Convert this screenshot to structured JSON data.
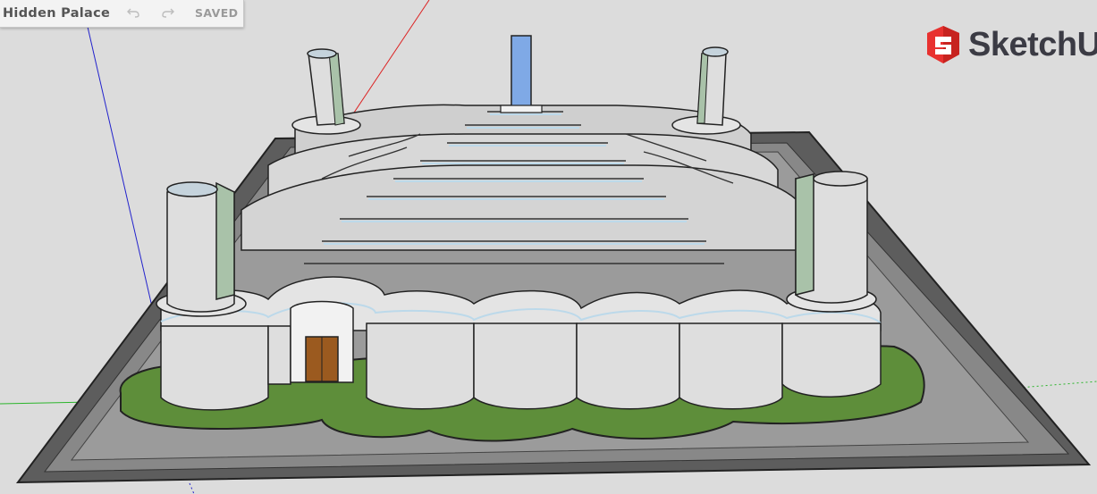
{
  "document": {
    "title": "Hidden Palace",
    "save_status": "SAVED"
  },
  "toolbar": {
    "undo_icon": "undo-icon",
    "redo_icon": "redo-icon"
  },
  "brand": {
    "name": "SketchU",
    "logo_icon": "sketchup-logo-icon",
    "logo_color": "#e8312f"
  },
  "colors": {
    "background": "#dcdcdc",
    "ground_plate": "#5d5d5d",
    "lawn": "#5e8e3a",
    "wall": "#dedede",
    "water_column": "#7fa9e6",
    "glass": "#a9c2a9",
    "door": "#9b5a1f",
    "axis_red": "#dd2222",
    "axis_green": "#2bb52b",
    "axis_blue": "#2222cc"
  }
}
